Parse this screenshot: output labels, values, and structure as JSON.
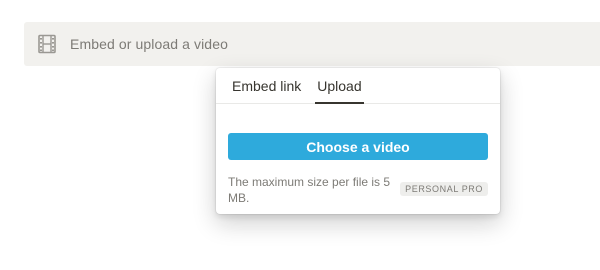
{
  "embed_block": {
    "icon": "film-icon",
    "label": "Embed or upload a video"
  },
  "popover": {
    "tabs": [
      {
        "label": "Embed link",
        "active": false
      },
      {
        "label": "Upload",
        "active": true
      }
    ],
    "upload": {
      "button_label": "Choose a video",
      "info_text": "The maximum size per file is 5 MB.",
      "badge": "PERSONAL PRO"
    }
  },
  "colors": {
    "accent": "#2eaadc",
    "text": "#37352f",
    "muted": "#7d7b76",
    "block_bg": "#f2f1ee"
  }
}
